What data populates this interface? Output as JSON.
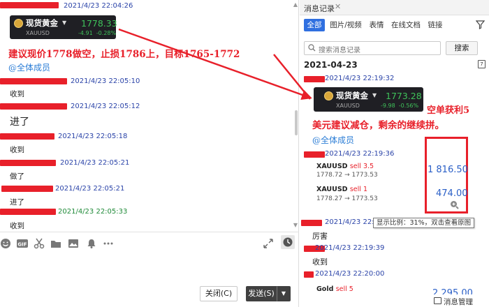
{
  "chat": {
    "messages": [
      {
        "time": "2021/4/23 22:04:26"
      },
      {
        "time": "2021/4/23 22:05:10",
        "body": "收到"
      },
      {
        "time": "2021/4/23 22:05:12",
        "body": "进了"
      },
      {
        "time": "2021/4/23 22:05:18",
        "body": "收到"
      },
      {
        "time": "2021/4/23 22:05:21",
        "body": "做了"
      },
      {
        "time": "2021/4/23 22:05:21",
        "body": "进了"
      },
      {
        "time": "2021/4/23 22:05:33",
        "body": "收到"
      }
    ],
    "quote_card": {
      "name": "现货黄金",
      "symbol": "XAUUSD",
      "price": "1778.33",
      "change": "-4.91",
      "change_pct": "-0.28%"
    },
    "annotation": "建议现价1778做空，止损1786上，目标1765-1772",
    "mention": "@全体成员"
  },
  "buttons": {
    "close": "关闭(C)",
    "send": "发送(S)"
  },
  "history": {
    "title": "消息记录",
    "tabs": [
      "全部",
      "图片/视频",
      "表情",
      "在线文档",
      "链接"
    ],
    "search_placeholder": "搜索消息记录",
    "search_button": "搜索",
    "date": "2021-04-23",
    "quote_card": {
      "name": "现货黄金",
      "symbol": "XAUUSD",
      "price": "1773.28",
      "change": "-9.98",
      "change_pct": "-0.56%"
    },
    "annotation_line1": "空单获利5",
    "annotation_line2": "美元建议减仓，剩余的继续拼。",
    "mention": "@全体成员",
    "times": [
      "2021/4/23 22:19:32",
      "2021/4/23 22:19:36",
      "2021/4/23 22:19:39",
      "2021/4/23 22:20:00"
    ],
    "times2": [
      "2021/4/23 22:19:38"
    ],
    "trades": [
      {
        "symbol": "XAUUSD",
        "side": "sell 3.5",
        "prices": "1778.72 → 1773.53",
        "value": "1 816.50"
      },
      {
        "symbol": "XAUUSD",
        "side": "sell 1",
        "prices": "1778.27 → 1773.53",
        "value": "474.00"
      }
    ],
    "tooltip": "显示比例：31%，双击查看原图",
    "bodies": [
      "厉害",
      "收到"
    ],
    "last_trade": {
      "symbol": "Gold",
      "side": "sell 5",
      "value": "2 295.00"
    },
    "manager": "消息管理"
  },
  "colors": {
    "accent": "#2f6fe0",
    "annotation_red": "#e8202a",
    "timestamp_blue": "#2a43a8",
    "positive_green": "#3fc25a"
  }
}
